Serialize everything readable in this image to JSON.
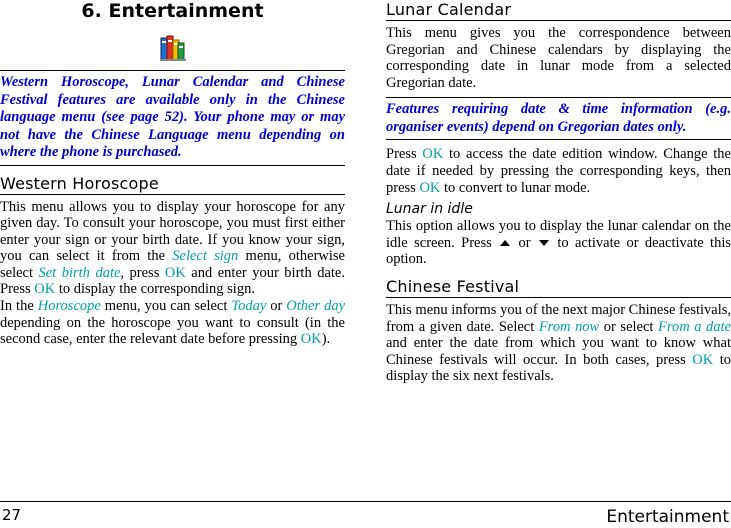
{
  "document": {
    "chapter_title": "6. Entertainment",
    "icon": "books-icon",
    "footer": {
      "page_number": "27",
      "section_title": "Entertainment"
    }
  },
  "left_column": {
    "intro_note": "Western Horoscope, Lunar Calendar and Chinese Festival features are available only in the Chinese language menu (see page 52). Your phone may or may not have the Chinese Language menu depending on where the phone is purchased.",
    "western_horoscope": {
      "heading": "Western Horoscope",
      "para1_a": "This menu allows you to display your horoscope for any given day. To consult your horoscope, you must first either enter your sign or your birth date. If you know your sign, you can select it from the ",
      "para1_kw1": "Select sign",
      "para1_b": " menu, otherwise select ",
      "para1_kw2": "Set birth date",
      "para1_c": ", press ",
      "para1_kw3": "OK",
      "para1_d": " and enter your birth date. Press ",
      "para1_kw4": "OK",
      "para1_e": " to display the corresponding sign.",
      "para2_a": "In the ",
      "para2_kw1": "Horoscope",
      "para2_b": " menu, you can select ",
      "para2_kw2": "Today",
      "para2_c": " or ",
      "para2_kw3": "Other day",
      "para2_d": " depending on the horoscope you want to consult (in the second case, enter the relevant date before pressing ",
      "para2_kw4": "OK",
      "para2_e": ")."
    }
  },
  "right_column": {
    "lunar_calendar": {
      "heading": "Lunar Calendar",
      "para1": "This menu gives you the correspondence between Gregorian and Chinese calendars by displaying the corresponding date in lunar mode from a selected Gregorian date.",
      "note": "Features requiring date & time information (e.g. organiser events) depend on Gregorian dates only.",
      "para2_a": "Press ",
      "para2_kw1": "OK",
      "para2_b": " to access the date edition window. Change the date if needed by pressing the corresponding keys, then press ",
      "para2_kw2": "OK",
      "para2_c": " to convert to lunar mode.",
      "subheading": "Lunar in idle",
      "para3_a": "This option allows you to display the lunar calendar on the idle screen. Press ",
      "para3_b": " or ",
      "para3_c": " to activate or deactivate this option."
    },
    "chinese_festival": {
      "heading": "Chinese Festival",
      "para1_a": "This menu informs you of the next major Chinese festivals, from a given date. Select ",
      "para1_kw1": "From now",
      "para1_b": " or select ",
      "para1_kw2": "From a date",
      "para1_c": " and enter the date from which you want to know what Chinese festivals will occur. In both cases, press ",
      "para1_kw3": "OK",
      "para1_d": " to display the six next festivals."
    }
  },
  "colors": {
    "note_blue": "#0000cc",
    "keyword_teal": "#00a0a8"
  }
}
